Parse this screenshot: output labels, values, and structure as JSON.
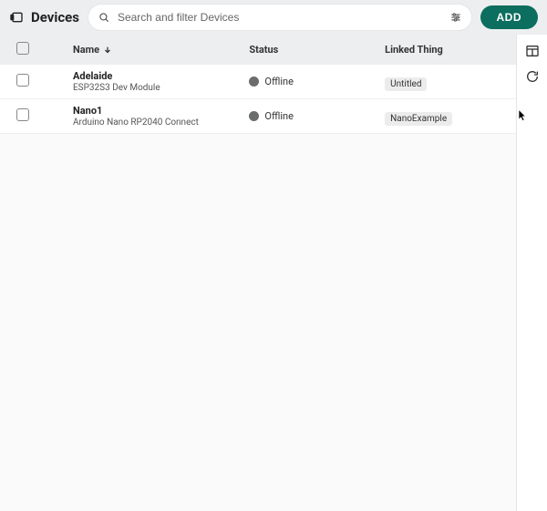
{
  "header": {
    "title": "Devices",
    "search_placeholder": "Search and filter Devices",
    "add_label": "ADD"
  },
  "columns": {
    "name": "Name",
    "status": "Status",
    "linked_thing": "Linked Thing"
  },
  "rows": [
    {
      "name": "Adelaide",
      "subtitle": "ESP32S3 Dev Module",
      "status": "Offline",
      "linked_thing": "Untitled",
      "thumb": "grey"
    },
    {
      "name": "Nano1",
      "subtitle": "Arduino Nano RP2040 Connect",
      "status": "Offline",
      "linked_thing": "NanoExample",
      "thumb": "teal"
    }
  ],
  "side": {
    "columns_tool": "columns-icon",
    "refresh_tool": "refresh-icon"
  }
}
